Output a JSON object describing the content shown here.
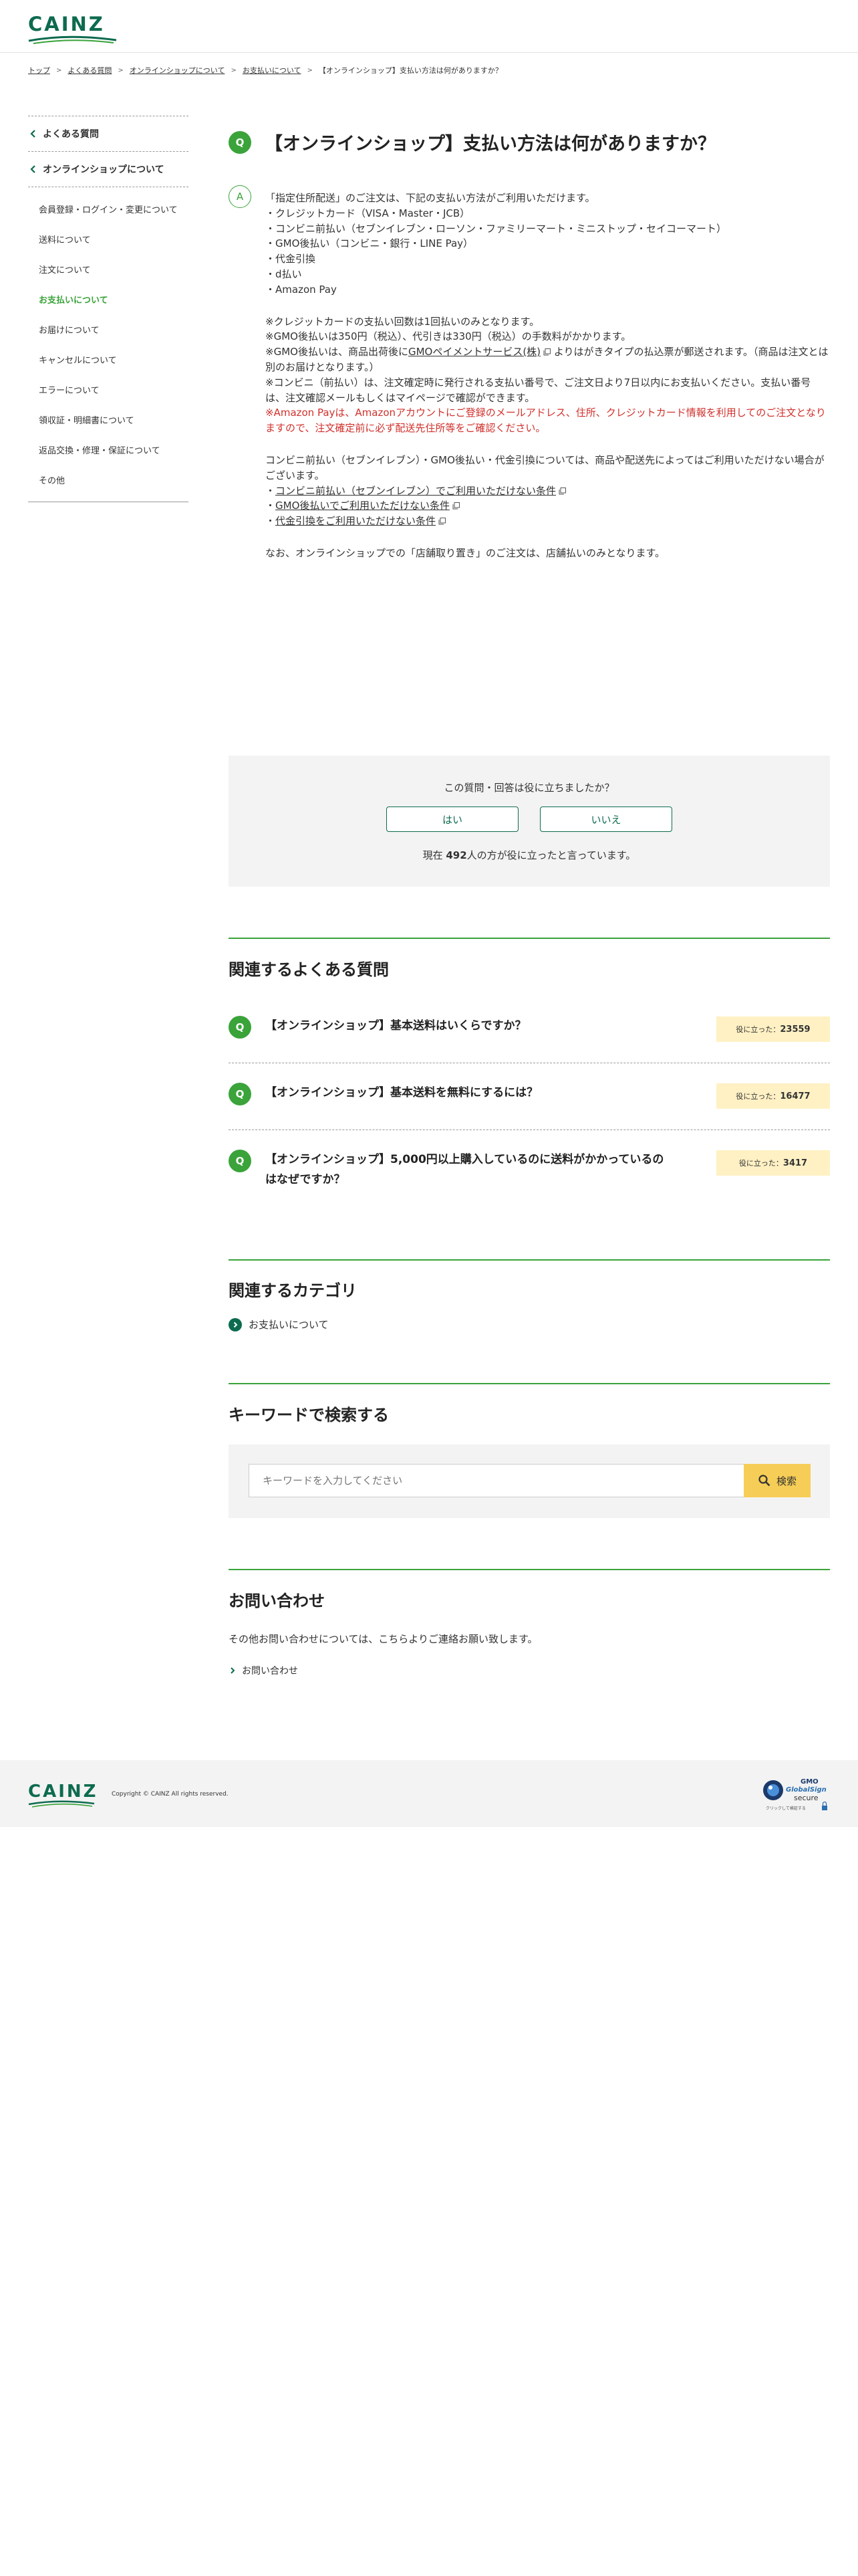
{
  "header": {
    "logo_text": "CAINZ"
  },
  "breadcrumb": [
    {
      "label": "トップ"
    },
    {
      "label": "よくある質問"
    },
    {
      "label": "オンラインショップについて"
    },
    {
      "label": "お支払いについて"
    },
    {
      "label": "【オンラインショップ】支払い方法は何がありますか？"
    }
  ],
  "sidebar": {
    "top_link": "よくある質問",
    "section_link": "オンラインショップについて",
    "items": [
      {
        "label": "会員登録・ログイン・変更について"
      },
      {
        "label": "送料について"
      },
      {
        "label": "注文について"
      },
      {
        "label": "お支払いについて",
        "active": true
      },
      {
        "label": "お届けについて"
      },
      {
        "label": "キャンセルについて"
      },
      {
        "label": "エラーについて"
      },
      {
        "label": "領収証・明細書について"
      },
      {
        "label": "返品交換・修理・保証について"
      },
      {
        "label": "その他"
      }
    ]
  },
  "question": {
    "badge": "Q",
    "title": "【オンラインショップ】支払い方法は何がありますか？"
  },
  "answer": {
    "badge": "A",
    "intro": "「指定住所配送」のご注文は、下記の支払い方法がご利用いただけます。",
    "methods": [
      "・クレジットカード（VISA・Master・JCB）",
      "・コンビニ前払い（セブンイレブン・ローソン・ファミリーマート・ミニストップ・セイコーマート）",
      "・GMO後払い（コンビニ・銀行・LINE Pay）",
      "・代金引換",
      "・d払い",
      "・Amazon Pay"
    ],
    "note1": "※クレジットカードの支払い回数は1回払いのみとなります。",
    "note2": "※GMO後払いは350円（税込）、代引きは330円（税込）の手数料がかかります。",
    "note3_pre": "※GMO後払いは、商品出荷後に",
    "note3_link": "GMOペイメントサービス(株)",
    "note3_post": "よりはがきタイプの払込票が郵送されます。（商品は注文とは別のお届けとなります。）",
    "note4": "※コンビニ（前払い）は、注文確定時に発行される支払い番号で、ご注文日より7日以内にお支払いください。支払い番号は、注文確認メールもしくはマイページで確認ができます。",
    "note5_red": "※Amazon Payは、Amazonアカウントにご登録のメールアドレス、住所、クレジットカード情報を利用してのご注文となりますので、注文確定前に必ず配送先住所等をご確認ください。",
    "para2": "コンビニ前払い（セブンイレブン）・GMO後払い・代金引換については、商品や配送先によってはご利用いただけない場合がございます。",
    "link1": "コンビニ前払い（セブンイレブン）でご利用いただけない条件",
    "link2": "GMO後払いでご利用いただけない条件",
    "link3": "代金引換をご利用いただけない条件",
    "bullet": "・",
    "para3": "なお、オンラインショップでの「店舗取り置き」のご注文は、店舗払いのみとなります。"
  },
  "feedback": {
    "question": "この質問・回答は役に立ちましたか？",
    "yes_label": "はい",
    "no_label": "いいえ",
    "count_prefix": "現在",
    "count": "492",
    "count_suffix": "人の方が役に立ったと言っています。"
  },
  "related": {
    "title": "関連するよくある質問",
    "helpful_label": "役に立った：",
    "items": [
      {
        "badge": "Q",
        "text": "【オンラインショップ】基本送料はいくらですか？",
        "count": "23559"
      },
      {
        "badge": "Q",
        "text": "【オンラインショップ】基本送料を無料にするには？",
        "count": "16477"
      },
      {
        "badge": "Q",
        "text": "【オンラインショップ】5,000円以上購入しているのに送料がかかっているのはなぜですか？",
        "count": "3417"
      }
    ]
  },
  "category": {
    "title": "関連するカテゴリ",
    "link": "お支払いについて"
  },
  "search": {
    "title": "キーワードで検索する",
    "placeholder": "キーワードを入力してください",
    "button_label": "検索"
  },
  "contact": {
    "title": "お問い合わせ",
    "text": "その他お問い合わせについては、こちらよりご連絡お願い致します。",
    "link": "お問い合わせ"
  },
  "footer": {
    "logo_text": "CAINZ",
    "copyright": "Copyright © CAINZ All rights reserved.",
    "seal_brand": "GMO",
    "seal_name": "GlobalSign",
    "seal_secure": "secure",
    "seal_sub": "クリックして検証する"
  },
  "colors": {
    "brand_green": "#0d6b4f",
    "accent_green": "#3aa33a",
    "warning_red": "#d0302b",
    "helpful_bg": "#fff1c4",
    "search_button": "#f6cd56"
  }
}
